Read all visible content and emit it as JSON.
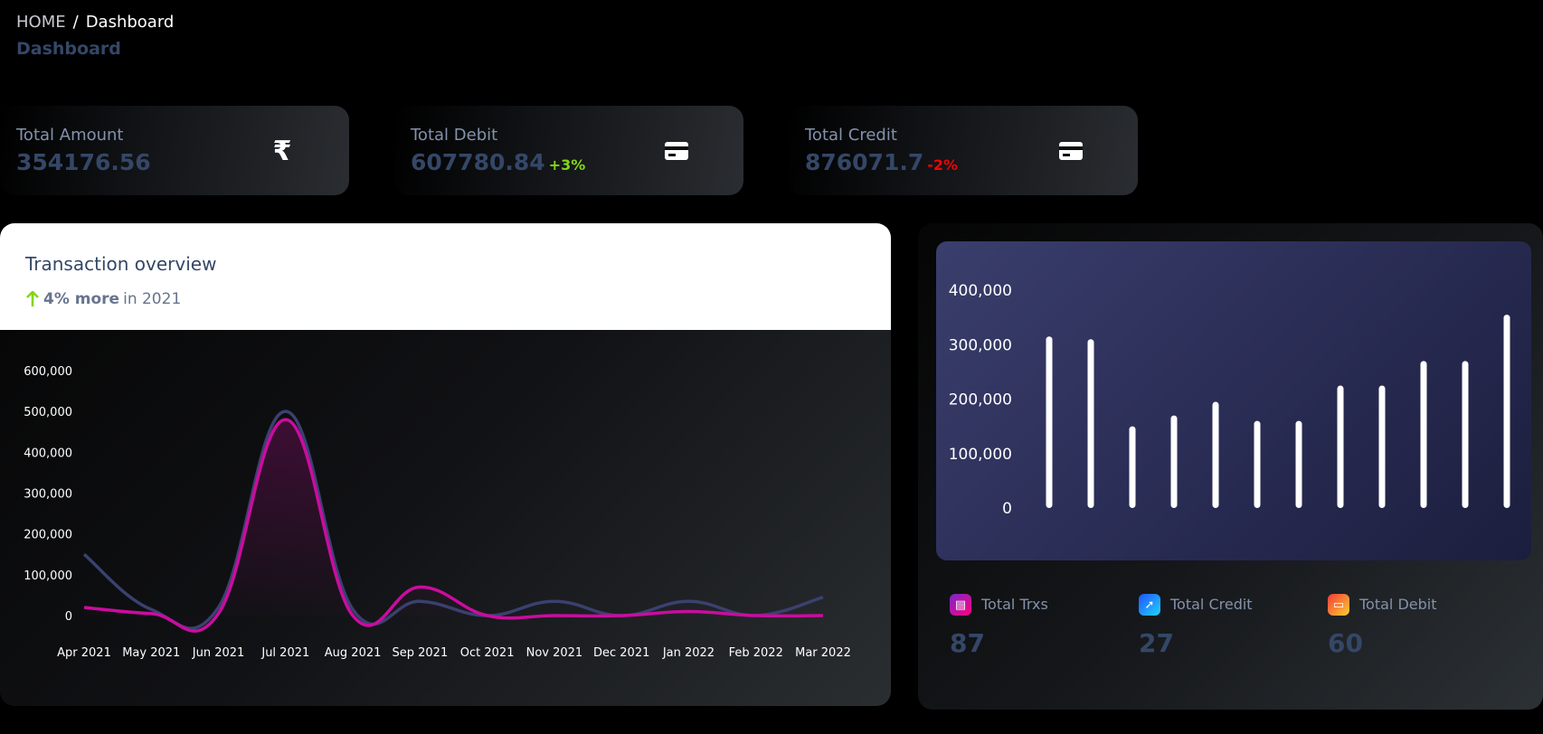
{
  "breadcrumb": {
    "home": "HOME",
    "sep": "/",
    "current": "Dashboard"
  },
  "page_title": "Dashboard",
  "stats": [
    {
      "label": "Total Amount",
      "value": "354176.56",
      "pct": "",
      "pct_color": "",
      "icon": "rupee-icon"
    },
    {
      "label": "Total Debit",
      "value": "607780.84",
      "pct": "+3%",
      "pct_color": "#82d616",
      "icon": "credit-card-icon"
    },
    {
      "label": "Total Credit",
      "value": "876071.7",
      "pct": "-2%",
      "pct_color": "#ea0606",
      "icon": "credit-card-icon"
    }
  ],
  "transaction": {
    "title": "Transaction overview",
    "sub_bold": "4% more",
    "sub_rest": "in 2021"
  },
  "mini_stats": [
    {
      "label": "Total Trxs",
      "value": "87",
      "color": "#d91cc9",
      "icon": "document-icon"
    },
    {
      "label": "Total Credit",
      "value": "27",
      "color": "#2196f3",
      "icon": "rocket-icon"
    },
    {
      "label": "Total Debit",
      "value": "60",
      "color": "#f5893a",
      "icon": "card-icon"
    }
  ],
  "chart_data": [
    {
      "type": "line",
      "x": [
        "Apr 2021",
        "May 2021",
        "Jun 2021",
        "Jul 2021",
        "Aug 2021",
        "Sep 2021",
        "Oct 2021",
        "Nov 2021",
        "Dec 2021",
        "Jan 2022",
        "Feb 2022",
        "Mar 2022"
      ],
      "ylim": [
        0,
        600000
      ],
      "yticks": [
        "600,000",
        "500,000",
        "400,000",
        "300,000",
        "200,000",
        "100,000",
        "0"
      ],
      "yticks_values": [
        600000,
        500000,
        400000,
        300000,
        200000,
        100000,
        0
      ],
      "series": [
        {
          "color": "#3a416f",
          "values": [
            150000,
            15000,
            20000,
            500000,
            15000,
            35000,
            0,
            35000,
            0,
            35000,
            0,
            45000
          ]
        },
        {
          "color": "#cb0c9f",
          "values": [
            20000,
            5000,
            5000,
            480000,
            0,
            70000,
            0,
            0,
            0,
            10000,
            0,
            0
          ]
        }
      ]
    },
    {
      "type": "bar",
      "ylim": [
        0,
        400000
      ],
      "yticks": [
        "400,000",
        "300,000",
        "200,000",
        "100,000",
        "0"
      ],
      "yticks_values": [
        400000,
        300000,
        200000,
        100000,
        0
      ],
      "values": [
        315000,
        310000,
        150000,
        170000,
        195000,
        160000,
        160000,
        225000,
        225000,
        270000,
        270000,
        355000
      ],
      "color": "#ffffff"
    }
  ]
}
